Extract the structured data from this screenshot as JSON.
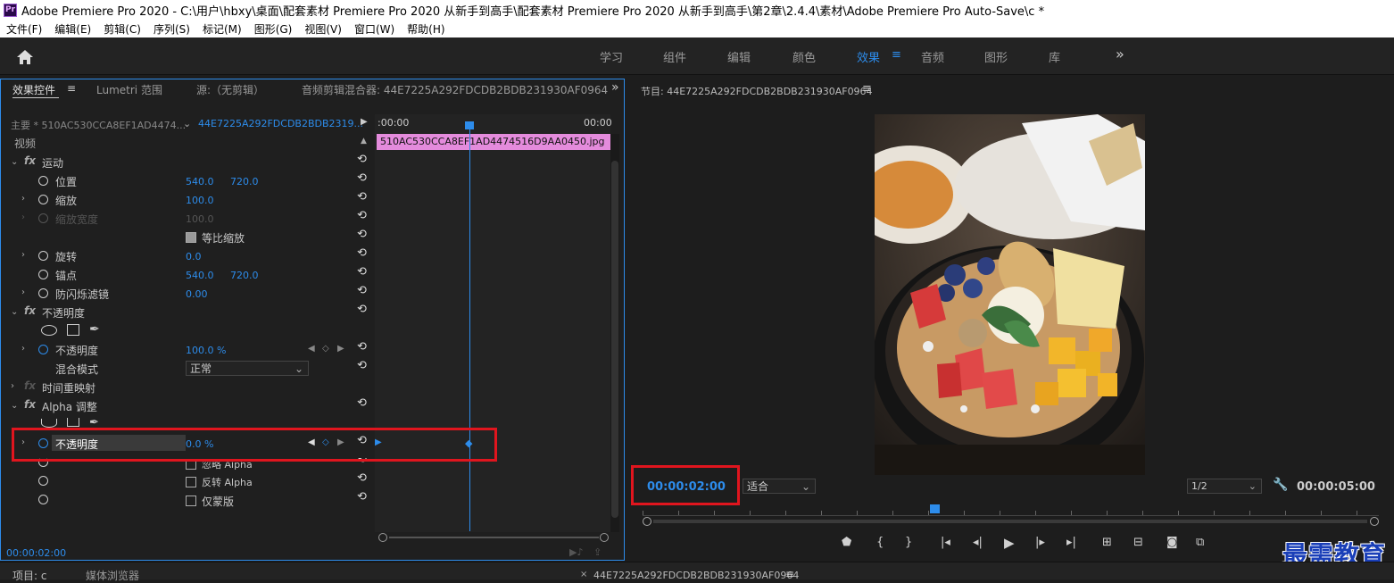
{
  "titlebar": {
    "logo": "Pr",
    "text": "Adobe Premiere Pro 2020 - C:\\用户\\hbxy\\桌面\\配套素材 Premiere Pro 2020 从新手到高手\\配套素材 Premiere Pro 2020 从新手到高手\\第2章\\2.4.4\\素材\\Adobe Premiere Pro Auto-Save\\c *"
  },
  "menu": [
    "文件(F)",
    "编辑(E)",
    "剪辑(C)",
    "序列(S)",
    "标记(M)",
    "图形(G)",
    "视图(V)",
    "窗口(W)",
    "帮助(H)"
  ],
  "workspaces": [
    "学习",
    "组件",
    "编辑",
    "颜色",
    "效果",
    "音频",
    "图形",
    "库"
  ],
  "workspace_more": "»",
  "panel_tabs": {
    "effect_controls": "效果控件",
    "lumetri": "Lumetri 范围",
    "source": "源:（无剪辑）",
    "audio_mixer": "音频剪辑混合器: 44E7225A292FDCDB2BDB231930AF0964",
    "more": "»"
  },
  "ec": {
    "master_clip": "主要 * 510AC530CCA8EF1AD4474...",
    "sequence_clip": "44E7225A292FDCDB2BDB2319...",
    "time_start": ":00:00",
    "time_end": "00:00",
    "clip_name": "510AC530CCA8EF1AD4474516D9AA0450.jpg",
    "video_label": "视频",
    "motion": "运动",
    "position": "位置",
    "position_x": "540.0",
    "position_y": "720.0",
    "scale": "缩放",
    "scale_val": "100.0",
    "scale_width": "缩放宽度",
    "scale_width_val": "100.0",
    "uniform_scale": "等比缩放",
    "rotation": "旋转",
    "rotation_val": "0.0",
    "anchor": "锚点",
    "anchor_x": "540.0",
    "anchor_y": "720.0",
    "antiflicker": "防闪烁滤镜",
    "antiflicker_val": "0.00",
    "opacity_group": "不透明度",
    "opacity": "不透明度",
    "opacity_val": "100.0 %",
    "blend_mode": "混合模式",
    "blend_val": "正常",
    "time_remap": "时间重映射",
    "alpha_adjust": "Alpha 调整",
    "alpha_opacity": "不透明度",
    "alpha_opacity_val": "0.0 %",
    "ignore_alpha": "忽略 Alpha",
    "invert_alpha": "反转 Alpha",
    "mask_only": "仅蒙版",
    "current_time": "00:00:02:00"
  },
  "program": {
    "title": "节目: 44E7225A292FDCDB2BDB231930AF0964",
    "timecode": "00:00:02:00",
    "fit": "适合",
    "resolution": "1/2",
    "duration": "00:00:05:00"
  },
  "bottom": {
    "project": "项目: c",
    "media_browser": "媒体浏览器",
    "timeline": "44E7225A292FDCDB2BDB231930AF0964"
  },
  "watermark": "最需教育",
  "colors": {
    "accent": "#2d8ceb",
    "highlight": "#e0151e",
    "clip": "#e48bdc"
  }
}
